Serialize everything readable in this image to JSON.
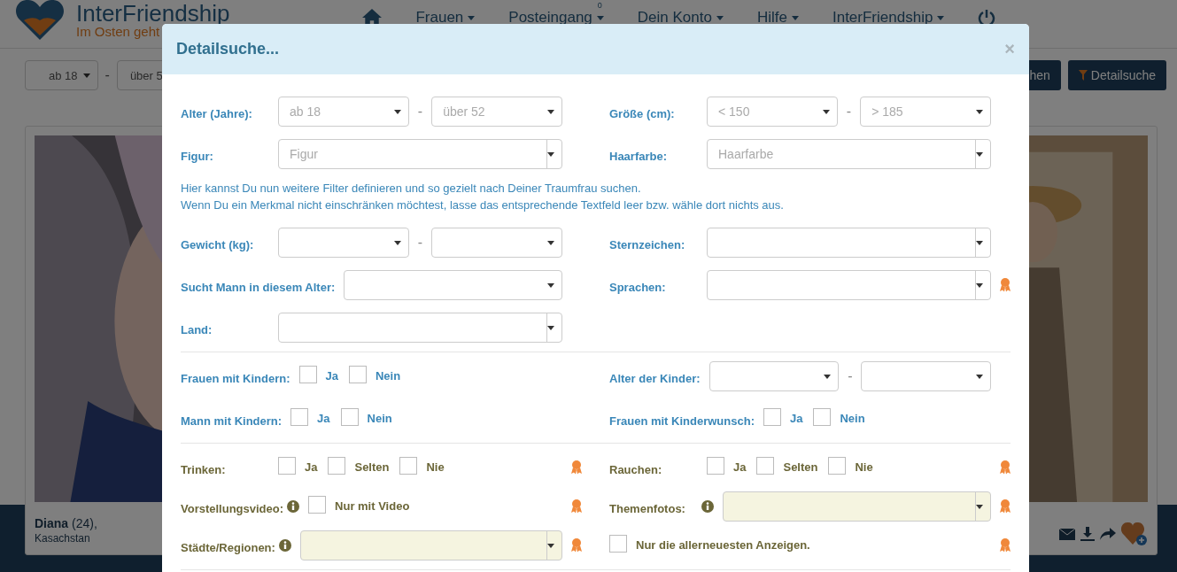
{
  "header": {
    "logo": {
      "name": "InterFriendship",
      "tagline": "Im Osten geht"
    },
    "nav": [
      {
        "label": "Frauen"
      },
      {
        "label": "Posteingang",
        "badge": "0"
      },
      {
        "label": "Dein Konto"
      },
      {
        "label": "Hilfe"
      },
      {
        "label": "InterFriendship"
      }
    ]
  },
  "filter_bar": {
    "selects": [
      "ab 18",
      "über 5"
    ],
    "separator": "-",
    "buttons": [
      {
        "label": "hen",
        "kind": "plain"
      },
      {
        "label": "Detailsuche",
        "kind": "filter"
      }
    ]
  },
  "profiles": [
    {
      "kind": "picture",
      "name": "**Diana** (24),",
      "country": "Kasachstan"
    },
    {
      "kind": "picture"
    }
  ],
  "modal": {
    "title": "Detailsuche...",
    "close": "×",
    "sections": [
      {
        "kind": "basic",
        "rows": [
          {
            "kind": "fields",
            "cells": [
              {
                "kind": "range",
                "label": "Alter (Jahre):",
                "separator": "-",
                "from": {
                  "placeholder": "ab 18"
                },
                "to": {
                  "placeholder": "über 52"
                }
              },
              {
                "kind": "range",
                "label": "Größe (cm):",
                "separator": "-",
                "from": {
                  "placeholder": "< 150"
                },
                "to": {
                  "placeholder": "> 185"
                }
              }
            ]
          },
          {
            "kind": "fields",
            "cells": [
              {
                "kind": "combo",
                "label": "Figur:",
                "placeholder": "Figur"
              },
              {
                "kind": "combo",
                "label": "Haarfarbe:",
                "placeholder": "Haarfarbe"
              }
            ]
          },
          {
            "kind": "note",
            "lines": [
              "Hier kannst Du nun weitere Filter definieren und so gezielt nach Deiner Traumfrau suchen.",
              "Wenn Du ein Merkmal nicht einschränken möchtest, lasse das entsprechende Textfeld leer bzw. wähle dort nichts aus."
            ]
          },
          {
            "kind": "fields",
            "cells": [
              {
                "kind": "range",
                "label": "Gewicht (kg):",
                "separator": "-"
              },
              {
                "kind": "combo",
                "label": "Sternzeichen:"
              }
            ]
          },
          {
            "kind": "fields",
            "cells": [
              {
                "kind": "select",
                "label": "Sucht Mann in diesem Alter:"
              },
              {
                "kind": "combo",
                "label": "Sprachen:",
                "award": true
              }
            ]
          },
          {
            "kind": "fields",
            "cells": [
              {
                "kind": "combo",
                "label": "Land:"
              }
            ]
          }
        ]
      },
      {
        "kind": "basic",
        "rows": [
          {
            "kind": "fields",
            "cells": [
              {
                "kind": "checks",
                "label": "Frauen mit Kindern:",
                "options": [
                  {
                    "label": "Ja",
                    "checked": false
                  },
                  {
                    "label": "Nein",
                    "checked": false
                  }
                ]
              },
              {
                "kind": "range",
                "label": "Alter der Kinder:",
                "separator": "-"
              }
            ]
          },
          {
            "kind": "fields",
            "cells": [
              {
                "kind": "checks",
                "label": "Mann mit Kindern:",
                "options": [
                  {
                    "label": "Ja",
                    "checked": false
                  },
                  {
                    "label": "Nein",
                    "checked": false
                  }
                ]
              },
              {
                "kind": "checks",
                "label": "Frauen mit Kinderwunsch:",
                "options": [
                  {
                    "label": "Ja",
                    "checked": false
                  },
                  {
                    "label": "Nein",
                    "checked": false
                  }
                ]
              }
            ]
          }
        ]
      },
      {
        "kind": "premium",
        "rows": [
          {
            "kind": "fields",
            "cells": [
              {
                "kind": "checks",
                "label": "Trinken:",
                "award": true,
                "options": [
                  {
                    "label": "Ja",
                    "checked": false
                  },
                  {
                    "label": "Selten",
                    "checked": false
                  },
                  {
                    "label": "Nie",
                    "checked": false
                  }
                ]
              },
              {
                "kind": "checks",
                "label": "Rauchen:",
                "award": true,
                "options": [
                  {
                    "label": "Ja",
                    "checked": false
                  },
                  {
                    "label": "Selten",
                    "checked": false
                  },
                  {
                    "label": "Nie",
                    "checked": false
                  }
                ]
              }
            ]
          },
          {
            "kind": "fields",
            "cells": [
              {
                "kind": "checks",
                "label": "Vorstellungsvideo:",
                "info": true,
                "award": true,
                "options": [
                  {
                    "label": "Nur mit Video",
                    "checked": false
                  }
                ]
              },
              {
                "kind": "combo",
                "label": "Themenfotos:",
                "info": true,
                "highlighted": true,
                "award": true
              }
            ]
          },
          {
            "kind": "fields",
            "cells": [
              {
                "kind": "combo",
                "label": "Städte/Regionen:",
                "info": true,
                "highlighted": true,
                "award": true
              },
              {
                "kind": "checks",
                "award": true,
                "options": [
                  {
                    "label": "Nur die allerneuesten Anzeigen.",
                    "checked": false
                  }
                ]
              }
            ]
          }
        ]
      }
    ]
  }
}
